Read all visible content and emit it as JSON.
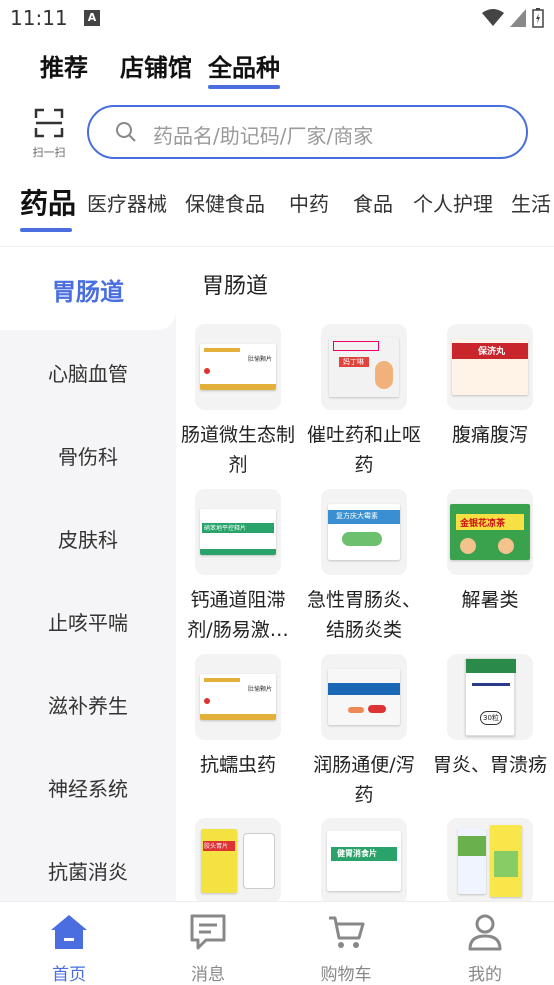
{
  "status": {
    "time": "11:11"
  },
  "top_tabs": [
    {
      "label": "推荐"
    },
    {
      "label": "店铺馆"
    },
    {
      "label": "全品种"
    }
  ],
  "scan": {
    "label": "扫一扫"
  },
  "search": {
    "placeholder": "药品名/助记码/厂家/商家"
  },
  "categories": [
    {
      "label": "药品"
    },
    {
      "label": "医疗器械"
    },
    {
      "label": "保健食品"
    },
    {
      "label": "中药"
    },
    {
      "label": "食品"
    },
    {
      "label": "个人护理"
    },
    {
      "label": "生活"
    }
  ],
  "sidebar": [
    {
      "label": "胃肠道"
    },
    {
      "label": "心脑血管"
    },
    {
      "label": "骨伤科"
    },
    {
      "label": "皮肤科"
    },
    {
      "label": "止咳平喘"
    },
    {
      "label": "滋补养生"
    },
    {
      "label": "神经系统"
    },
    {
      "label": "抗菌消炎"
    }
  ],
  "content": {
    "title": "胃肠道",
    "items": [
      {
        "name": "肠道微生态制剂",
        "box_text": "肚愉颗片"
      },
      {
        "name": "催吐药和止呕药",
        "box_text": "妈丁啉"
      },
      {
        "name": "腹痛腹泻",
        "box_text": "保济丸"
      },
      {
        "name": "钙通道阻滞剂/肠易激综合征",
        "box_text": "硝苯地平控释片"
      },
      {
        "name": "急性胃肠炎、结肠炎类",
        "box_text": "复方庆大霉素"
      },
      {
        "name": "解暑类",
        "box_text": "金银花凉茶"
      },
      {
        "name": "抗蠕虫药",
        "box_text": "肚愉颗片"
      },
      {
        "name": "润肠通便/泻药",
        "box_text": ""
      },
      {
        "name": "胃炎、胃溃疡",
        "box_text": "30粒"
      },
      {
        "name": "",
        "box_text": "胶头胃片"
      },
      {
        "name": "",
        "box_text": "健胃消食片"
      },
      {
        "name": "",
        "box_text": ""
      }
    ]
  },
  "bottom_nav": [
    {
      "label": "首页"
    },
    {
      "label": "消息"
    },
    {
      "label": "购物车"
    },
    {
      "label": "我的"
    }
  ],
  "colors": {
    "accent": "#4a6ee0",
    "sidebar_bg": "#f5f5f7"
  }
}
